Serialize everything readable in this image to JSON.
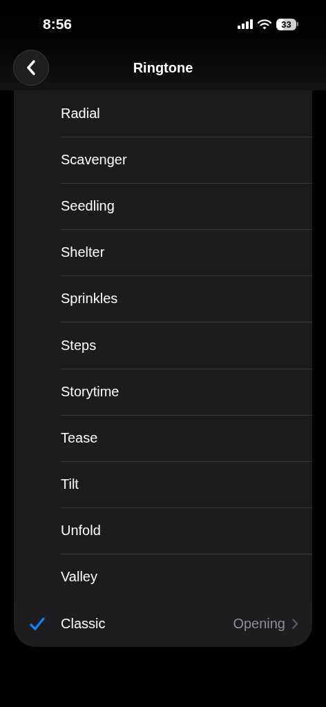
{
  "status_bar": {
    "time": "8:56",
    "battery": "33"
  },
  "header": {
    "title": "Ringtone"
  },
  "items": [
    {
      "label": "Radial",
      "selected": false
    },
    {
      "label": "Scavenger",
      "selected": false
    },
    {
      "label": "Seedling",
      "selected": false
    },
    {
      "label": "Shelter",
      "selected": false
    },
    {
      "label": "Sprinkles",
      "selected": false
    },
    {
      "label": "Steps",
      "selected": false
    },
    {
      "label": "Storytime",
      "selected": false
    },
    {
      "label": "Tease",
      "selected": false
    },
    {
      "label": "Tilt",
      "selected": false
    },
    {
      "label": "Unfold",
      "selected": false
    },
    {
      "label": "Valley",
      "selected": false
    },
    {
      "label": "Classic",
      "selected": true,
      "detail": "Opening"
    }
  ]
}
